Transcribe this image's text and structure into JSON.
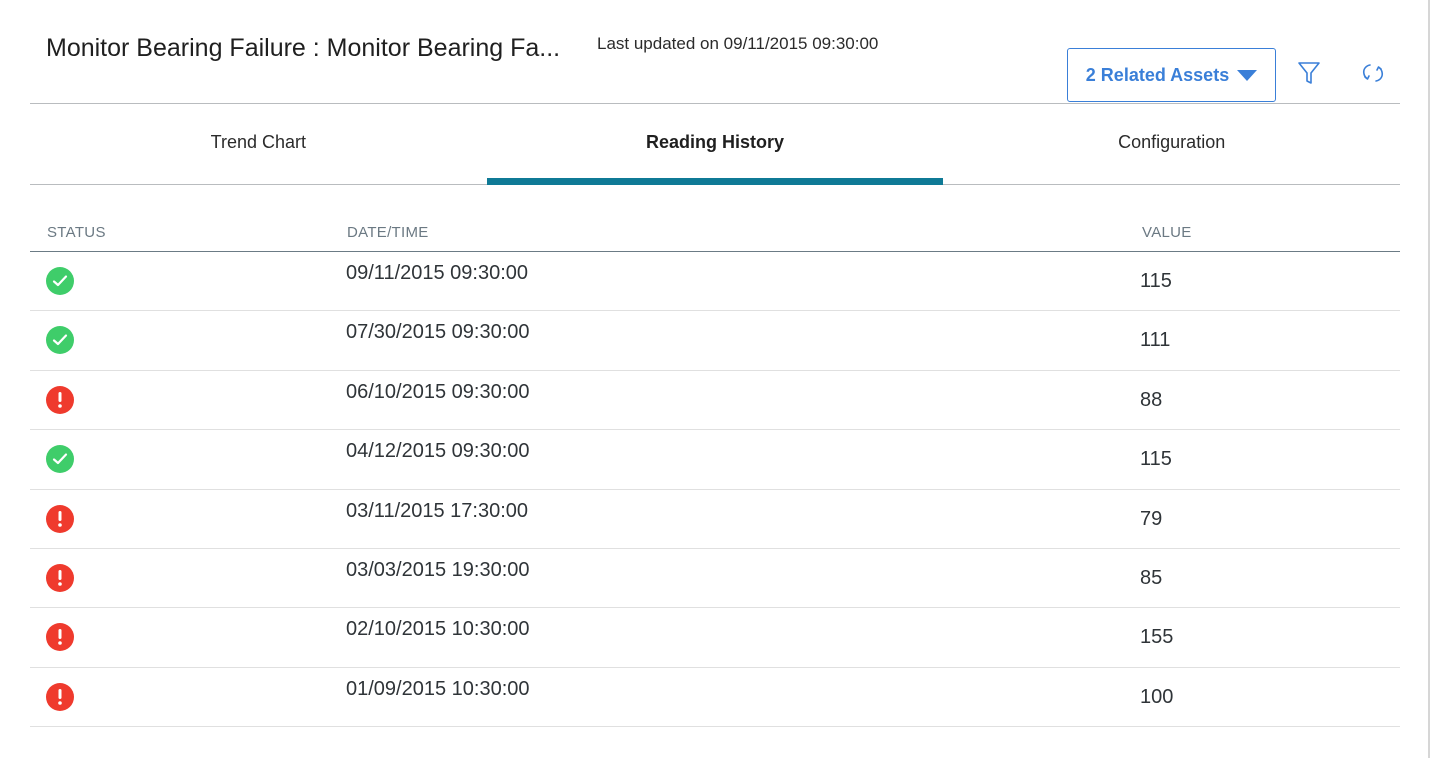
{
  "header": {
    "title": "Monitor Bearing Failure : Monitor Bearing Fa...",
    "last_updated": "Last updated on 09/11/2015 09:30:00",
    "related_assets_label": "2 Related Assets",
    "filter_icon": "filter-icon",
    "refresh_icon": "refresh-icon"
  },
  "tabs": [
    {
      "label": "Trend Chart",
      "active": false
    },
    {
      "label": "Reading History",
      "active": true
    },
    {
      "label": "Configuration",
      "active": false
    }
  ],
  "table": {
    "columns": [
      "STATUS",
      "DATE/TIME",
      "VALUE"
    ],
    "rows": [
      {
        "status": "ok",
        "datetime": "09/11/2015 09:30:00",
        "value": "115"
      },
      {
        "status": "ok",
        "datetime": "07/30/2015 09:30:00",
        "value": "111"
      },
      {
        "status": "alert",
        "datetime": "06/10/2015 09:30:00",
        "value": "88"
      },
      {
        "status": "ok",
        "datetime": "04/12/2015 09:30:00",
        "value": "115"
      },
      {
        "status": "alert",
        "datetime": "03/11/2015 17:30:00",
        "value": "79"
      },
      {
        "status": "alert",
        "datetime": "03/03/2015 19:30:00",
        "value": "85"
      },
      {
        "status": "alert",
        "datetime": "02/10/2015 10:30:00",
        "value": "155"
      },
      {
        "status": "alert",
        "datetime": "01/09/2015 10:30:00",
        "value": "100"
      }
    ]
  },
  "colors": {
    "accent": "#3a7fd8",
    "tab_indicator": "#0f7a96",
    "status_ok": "#3fcd6a",
    "status_alert": "#ef3a2d"
  }
}
